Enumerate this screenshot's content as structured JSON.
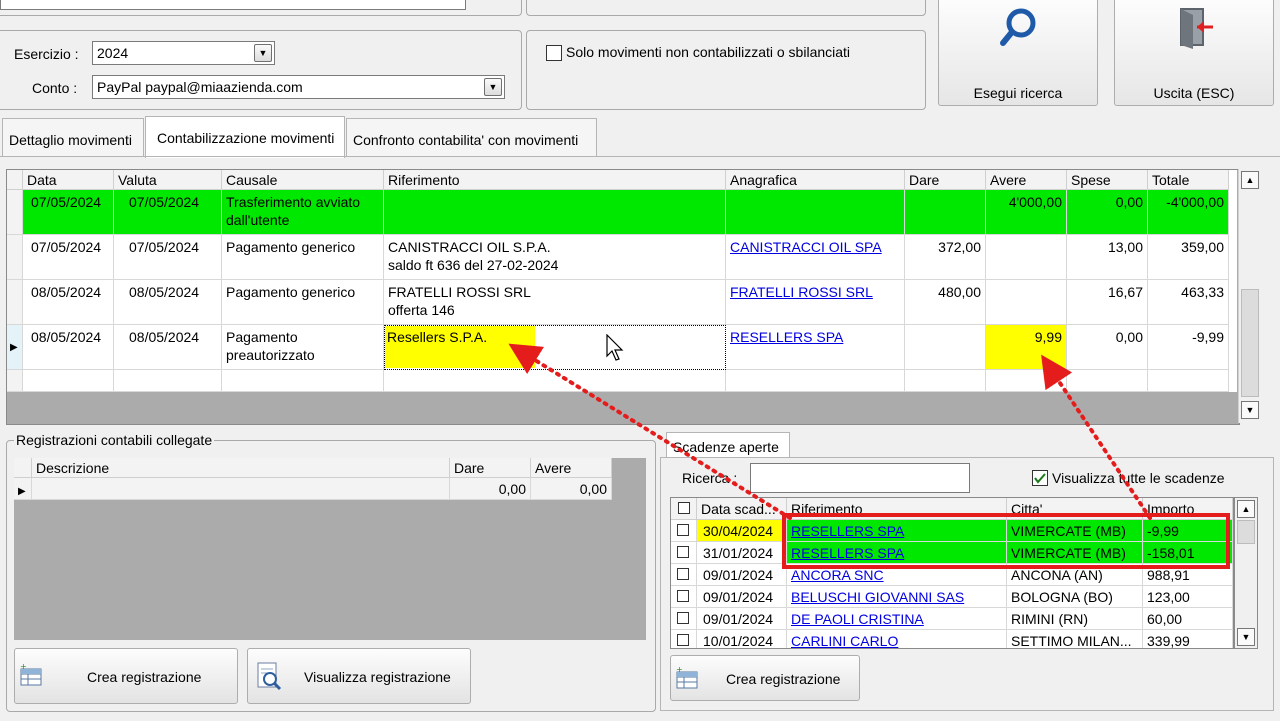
{
  "filters": {
    "esercizio_label": "Esercizio :",
    "esercizio_value": "2024",
    "conto_label": "Conto :",
    "conto_value": "PayPal paypal@miaazienda.com",
    "solo_movimenti_label": "Solo movimenti non contabilizzati o sbilanciati"
  },
  "actions": {
    "search_label": "Esegui ricerca",
    "exit_label": "Uscita (ESC)"
  },
  "tabs": [
    {
      "label": "Dettaglio movimenti"
    },
    {
      "label": "Contabilizzazione movimenti"
    },
    {
      "label": "Confronto contabilita' con movimenti"
    }
  ],
  "movements": {
    "columns": [
      "Data",
      "Valuta",
      "Causale",
      "Riferimento",
      "Anagrafica",
      "Dare",
      "Avere",
      "Spese",
      "Totale"
    ],
    "rows": [
      {
        "data": "07/05/2024",
        "valuta": "07/05/2024",
        "causale": "Trasferimento avviato\ndall'utente",
        "riferimento": "",
        "anagrafica": "",
        "dare": "",
        "avere": "4'000,00",
        "spese": "0,00",
        "totale": "-4'000,00"
      },
      {
        "data": "07/05/2024",
        "valuta": "07/05/2024",
        "causale": "Pagamento generico",
        "riferimento": "CANISTRACCI OIL S.P.A.\nsaldo ft 636 del 27-02-2024",
        "anagrafica": "CANISTRACCI OIL SPA",
        "dare": "372,00",
        "avere": "",
        "spese": "13,00",
        "totale": "359,00"
      },
      {
        "data": "08/05/2024",
        "valuta": "08/05/2024",
        "causale": "Pagamento generico",
        "riferimento": "FRATELLI ROSSI SRL\nofferta 146",
        "anagrafica": "FRATELLI ROSSI SRL",
        "dare": "480,00",
        "avere": "",
        "spese": "16,67",
        "totale": "463,33"
      },
      {
        "data": "08/05/2024",
        "valuta": "08/05/2024",
        "causale": "Pagamento\npreautorizzato",
        "riferimento": "Resellers S.P.A.",
        "anagrafica": "RESELLERS SPA",
        "dare": "",
        "avere": "9,99",
        "spese": "0,00",
        "totale": "-9,99"
      }
    ]
  },
  "registrazioni": {
    "title": "Registrazioni contabili collegate",
    "columns": [
      "Descrizione",
      "Dare",
      "Avere"
    ],
    "row": {
      "descrizione": "",
      "dare": "0,00",
      "avere": "0,00"
    },
    "crea_label": "Crea registrazione",
    "visualizza_label": "Visualizza registrazione"
  },
  "scadenze": {
    "tab_label": "Scadenze aperte",
    "ricerca_label": "Ricerca :",
    "ricerca_value": "",
    "visualizza_tutte_label": "Visualizza tutte le scadenze",
    "columns": [
      "Data scad...",
      "Riferimento",
      "Citta'",
      "Importo"
    ],
    "rows": [
      {
        "data": "30/04/2024",
        "riferimento": "RESELLERS SPA",
        "citta": "VIMERCATE (MB)",
        "importo": "-9,99"
      },
      {
        "data": "31/01/2024",
        "riferimento": "RESELLERS SPA",
        "citta": "VIMERCATE (MB)",
        "importo": "-158,01"
      },
      {
        "data": "09/01/2024",
        "riferimento": "ANCORA SNC",
        "citta": "ANCONA (AN)",
        "importo": "988,91"
      },
      {
        "data": "09/01/2024",
        "riferimento": "BELUSCHI GIOVANNI SAS",
        "citta": "BOLOGNA (BO)",
        "importo": "123,00"
      },
      {
        "data": "09/01/2024",
        "riferimento": "DE PAOLI CRISTINA",
        "citta": "RIMINI (RN)",
        "importo": "60,00"
      },
      {
        "data": "10/01/2024",
        "riferimento": "CARLINI CARLO",
        "citta": "SETTIMO MILAN...",
        "importo": "339,99"
      }
    ],
    "crea_label": "Crea registrazione"
  },
  "colors": {
    "highlight_green": "#00e800",
    "highlight_yellow": "#ffff00",
    "annotation_red": "#e51c1c",
    "link_blue": "#0000e0"
  }
}
